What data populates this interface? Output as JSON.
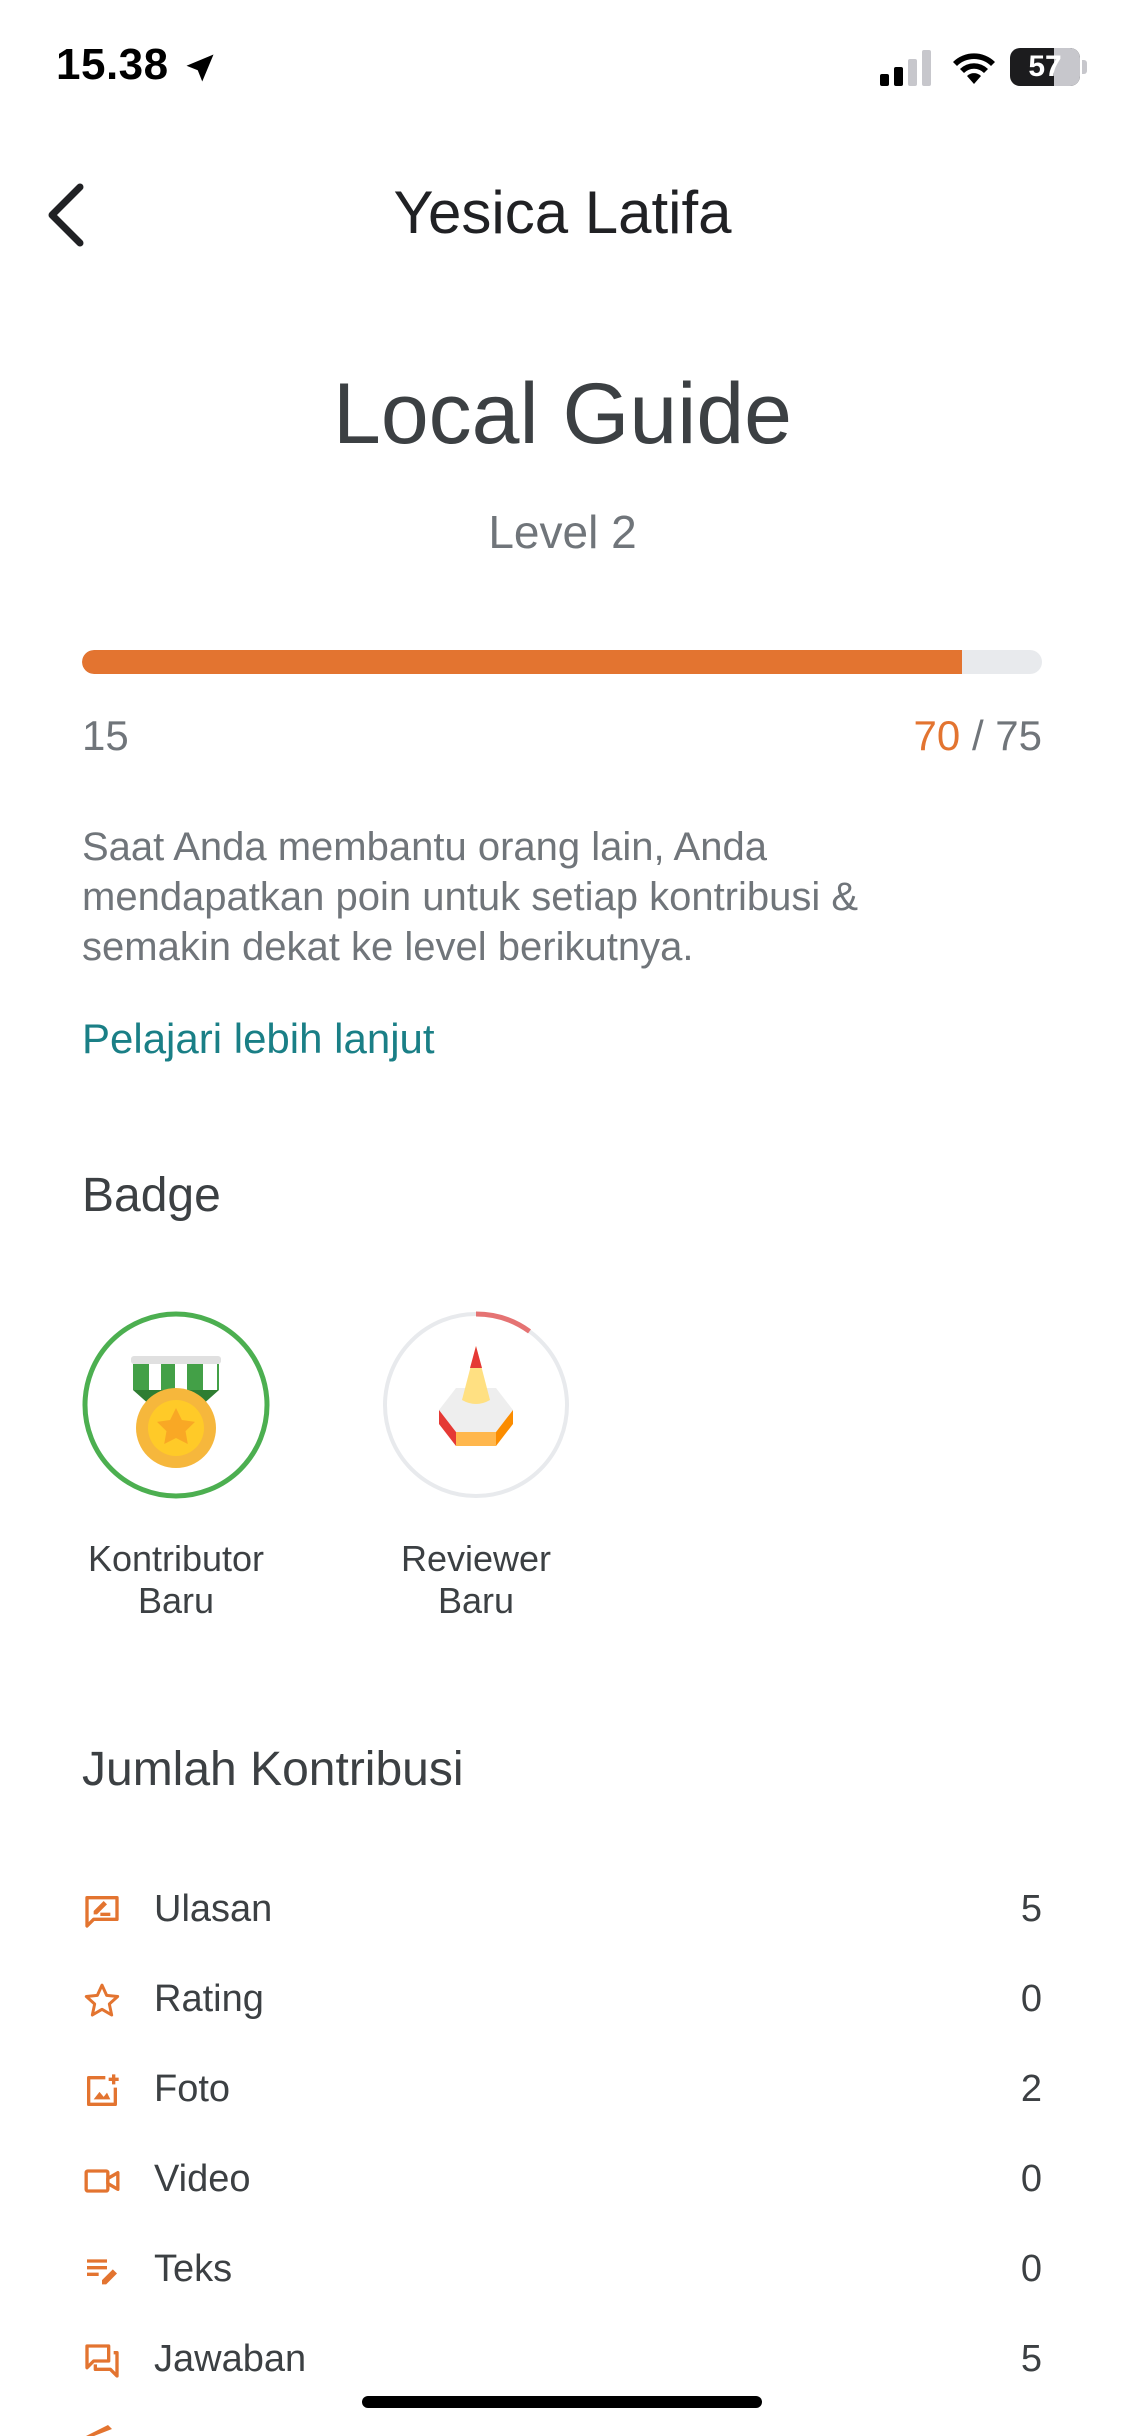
{
  "status_bar": {
    "time": "15.38",
    "battery": "57"
  },
  "header": {
    "title": "Yesica Latifa"
  },
  "level": {
    "title": "Local Guide",
    "subtitle": "Level 2",
    "progress_min": "15",
    "progress_current": "70",
    "progress_separator": "/",
    "progress_max": "75",
    "progress_fraction": 0.917
  },
  "description": "Saat Anda membantu orang lain, Anda mendapatkan poin untuk setiap kontribusi & semakin dekat ke level berikutnya.",
  "learn_more": "Pelajari lebih lanjut",
  "badges": {
    "title": "Badge",
    "items": [
      {
        "line1": "Kontributor",
        "line2": "Baru",
        "progress_fraction": 1.0,
        "ring_color": "#4caf50"
      },
      {
        "line1": "Reviewer",
        "line2": "Baru",
        "progress_fraction": 0.1,
        "ring_color": "#e57373"
      }
    ]
  },
  "contributions": {
    "title": "Jumlah Kontribusi",
    "items": [
      {
        "label": "Ulasan",
        "count": "5",
        "icon": "review-icon"
      },
      {
        "label": "Rating",
        "count": "0",
        "icon": "star-icon"
      },
      {
        "label": "Foto",
        "count": "2",
        "icon": "add-photo-icon"
      },
      {
        "label": "Video",
        "count": "0",
        "icon": "video-icon"
      },
      {
        "label": "Teks",
        "count": "0",
        "icon": "edit-text-icon"
      },
      {
        "label": "Jawaban",
        "count": "5",
        "icon": "answer-icon"
      }
    ]
  },
  "colors": {
    "accent": "#e37430",
    "link": "#1a7f86",
    "track": "#e8eaed"
  }
}
